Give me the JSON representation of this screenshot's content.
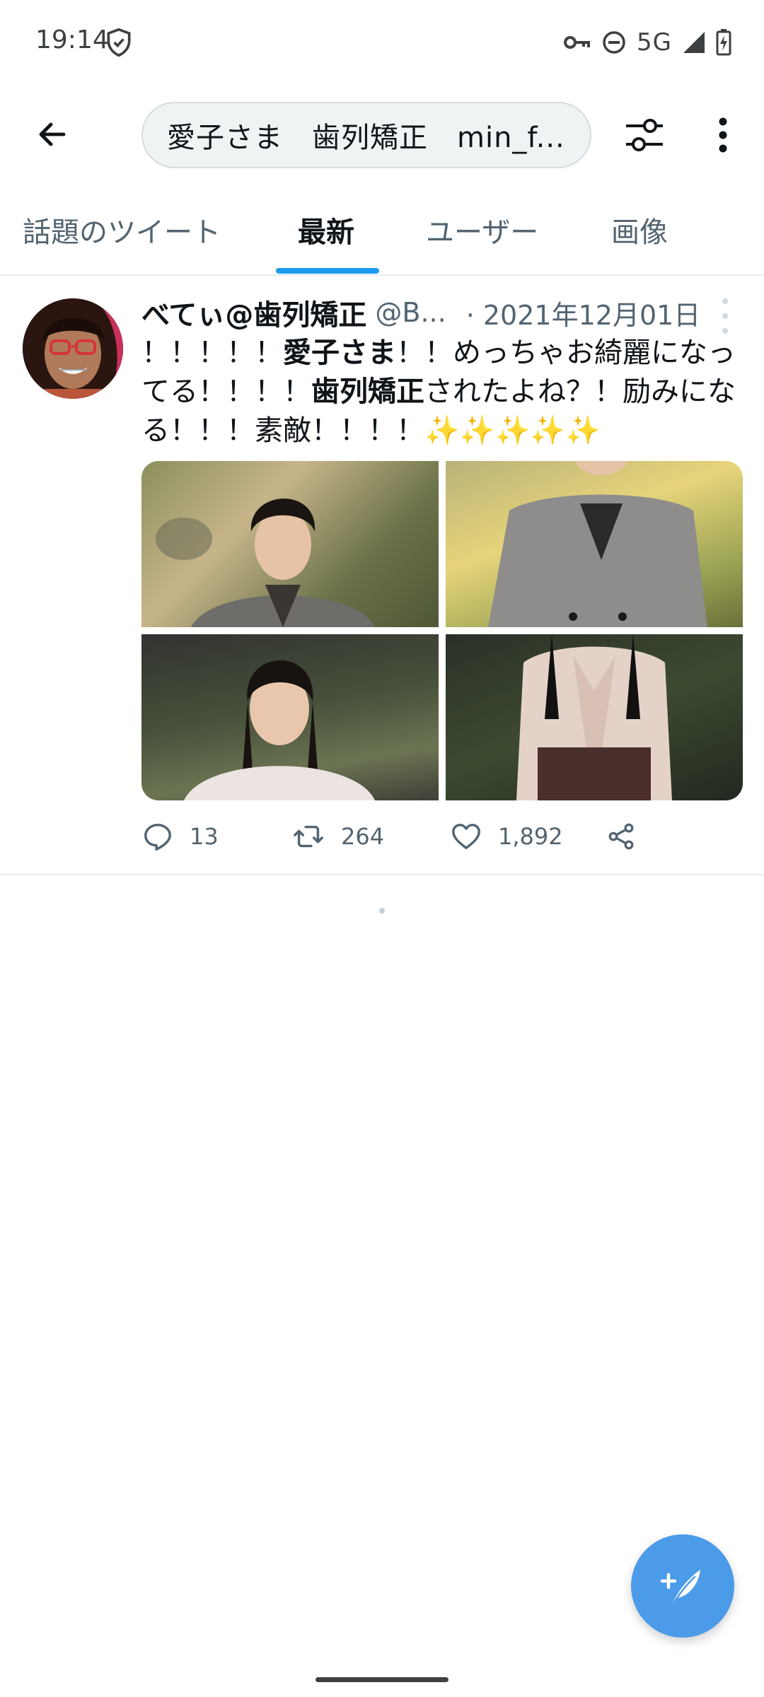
{
  "status_bar": {
    "time": "19:14",
    "network": "5G"
  },
  "search": {
    "query": "愛子さま　歯列矯正　min_f..."
  },
  "tabs": [
    {
      "label": "話題のツイート",
      "active": false
    },
    {
      "label": "最新",
      "active": true
    },
    {
      "label": "ユーザー",
      "active": false
    },
    {
      "label": "画像",
      "active": false
    }
  ],
  "tweet": {
    "name": "べてぃ@歯列矯正",
    "handle": "@B...",
    "date": "· 2021年12月01日",
    "text_parts": [
      {
        "text": "！！！！！",
        "bold": false
      },
      {
        "text": "愛子さま",
        "bold": true
      },
      {
        "text": "！！めっちゃお綺麗になってる！！！！",
        "bold": false
      },
      {
        "text": "歯列矯正",
        "bold": true
      },
      {
        "text": "されたよね？！励みになる！！！素敵！！！！",
        "bold": false
      },
      {
        "text": "✨✨✨✨✨",
        "bold": false
      }
    ],
    "photo_count": 4,
    "reply_count": "13",
    "retweet_count": "264",
    "like_count": "1,892"
  },
  "icons": {
    "back": "back-arrow-icon",
    "filter": "filter-sliders-icon",
    "more": "more-vertical-icon",
    "reply": "reply-icon",
    "retweet": "retweet-icon",
    "like": "heart-icon",
    "share": "share-icon",
    "compose": "compose-feather-icon"
  },
  "colors": {
    "accent": "#1d9bf0",
    "fab": "#4c9be8",
    "secondary_text": "#536471"
  }
}
